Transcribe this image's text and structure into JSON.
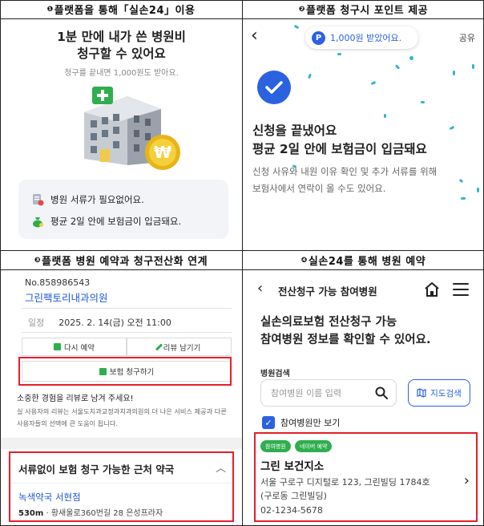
{
  "headers": {
    "p1": {
      "num": "❶",
      "text": "플랫폼을 통해「실손24」이용"
    },
    "p2": {
      "num": "❷",
      "text": "플랫폼 청구시 포인트 제공"
    },
    "p3": {
      "num": "❸",
      "text": "플랫폼 병원 예약과 청구전산화 연계"
    },
    "p4": {
      "num": "❹",
      "text": "실손24를 통해 병원 예약"
    }
  },
  "panel1": {
    "title_line1": "1분 만에 내가 쓴 병원비",
    "title_line2": "청구할 수 있어요",
    "subtitle": "청구를 끝내면 1,000원도 받아요.",
    "coin_symbol": "₩",
    "building_plus": "+",
    "items": [
      {
        "icon": "document-icon",
        "text": "병원 서류가 필요없어요."
      },
      {
        "icon": "money-bag-icon",
        "text": "평균 2일 안에 보험금이 입금돼요."
      }
    ]
  },
  "panel2": {
    "back_label": "‹",
    "point_coin": "P",
    "point_text": "1,000원 받았어요.",
    "share_label": "공유",
    "heading_line1": "신청을 끝냈어요",
    "heading_line2": "평균 2일 안에 보험금이 입금돼요",
    "body_line1": "신청 사유와 내원 이유 확인 및 추가 서류를 위해",
    "body_line2": "보험사에서 연락이 올 수도 있어요."
  },
  "panel3": {
    "reservation_no": "No.858986543",
    "clinic_name": "그린팩토리내과의원",
    "date_label": "일정",
    "date_value": "2025. 2. 14(금) 오전 11:00",
    "btn_rebook": "다시 예약",
    "btn_review": "리뷰 남기기",
    "btn_claim": "보험 청구하기",
    "review_title": "소중한 경험을 리뷰로 남겨 주세요!",
    "review_body_line1": "실 사용자의 리뷰는 서울도치과교정과치과의원의 더 나은 서비스 제공과 다른",
    "review_body_line2": "사용자들의 선택에 큰 도움이 됩니다.",
    "pharmacy_section_title": "서류없이 보험 청구 가능한 근처 약국",
    "pharmacy_name": "녹색약국 서현점",
    "pharmacy_distance": "530m",
    "pharmacy_address": "· 황새울로360번길 28 은성프라자"
  },
  "panel4": {
    "back_label": "‹",
    "title": "전산청구 가능 참여병원",
    "heading_line1": "실손의료보험 전산청구 가능",
    "heading_line2": "참여병원 정보를 확인할 수 있어요.",
    "search_label": "병원검색",
    "search_placeholder": "참여병원 이름 입력",
    "map_button": "지도검색",
    "checkbox_label": "참여병원만 보기",
    "tag_participating": "참여병원",
    "tag_naver": "네이버 예약",
    "hospital_name": "그린 보건지소",
    "address_line1": "서울 구로구 디지털로 123, 그린빌딩 1784호",
    "address_line2": "(구로동 그린빌딩)",
    "phone": "02-1234-5678"
  },
  "colors": {
    "brand_blue": "#2a62e0",
    "highlight_red": "#e51e2a",
    "tag_green": "#2fae4e"
  }
}
